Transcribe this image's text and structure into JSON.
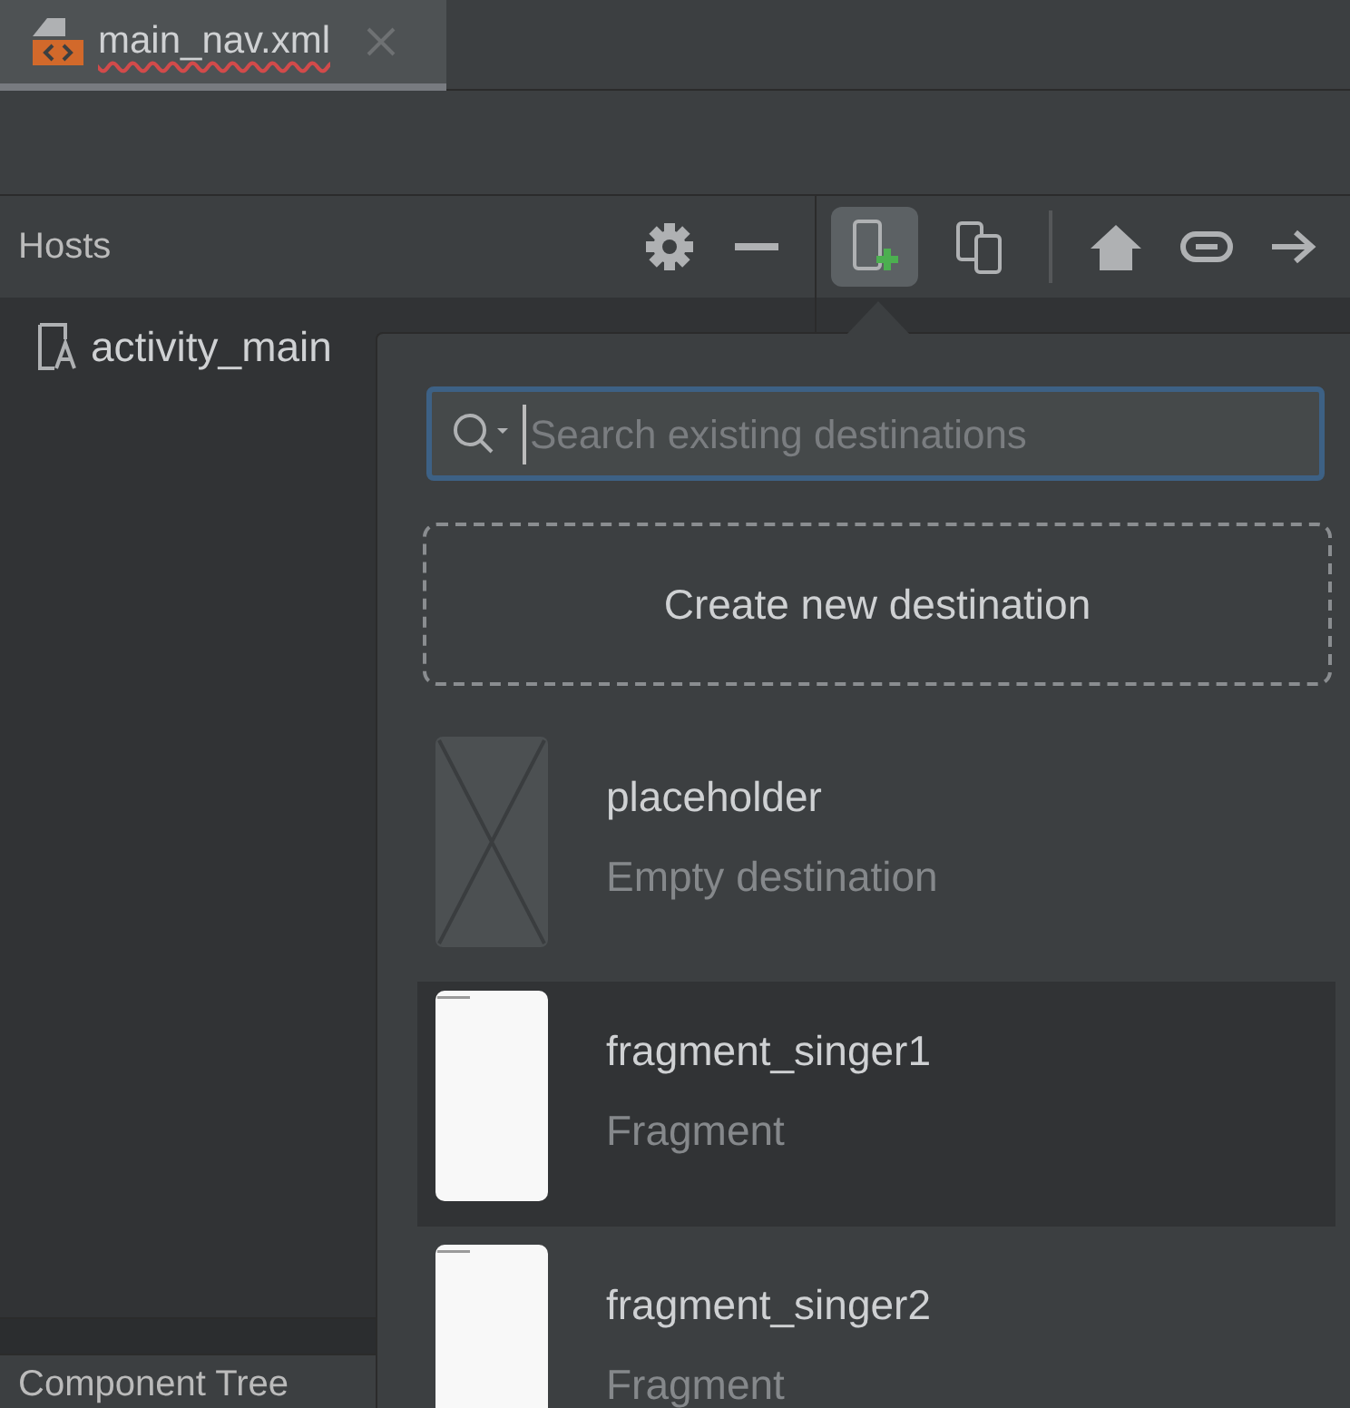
{
  "editor_tab": {
    "label": "main_nav.xml"
  },
  "hosts_panel": {
    "title": "Hosts",
    "items": [
      {
        "label": "activity_main"
      }
    ]
  },
  "bottom_panel": {
    "title": "Component Tree"
  },
  "toolbar": {
    "new_destination_active": true
  },
  "destination_popup": {
    "search": {
      "placeholder": "Search existing destinations"
    },
    "create_label": "Create new destination",
    "items": [
      {
        "kind": "placeholder",
        "name": "placeholder",
        "type": "Empty destination",
        "selected": false
      },
      {
        "kind": "fragment",
        "name": "fragment_singer1",
        "type": "Fragment",
        "selected": true
      },
      {
        "kind": "fragment",
        "name": "fragment_singer2",
        "type": "Fragment",
        "selected": false
      }
    ]
  }
}
